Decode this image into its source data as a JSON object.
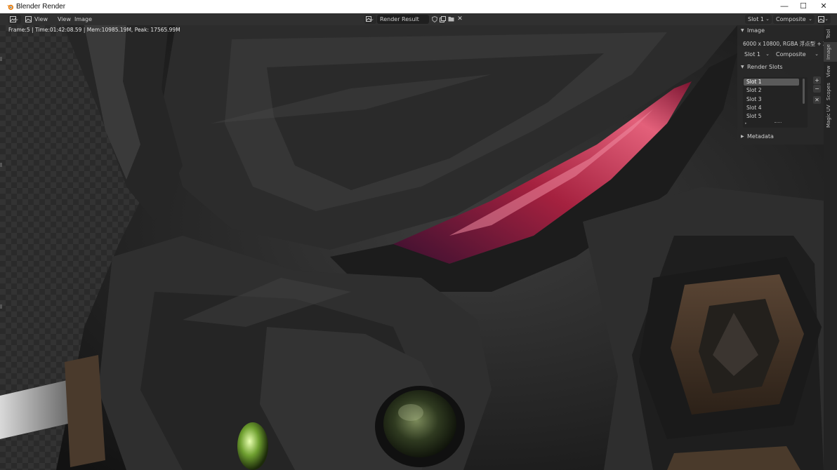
{
  "window": {
    "title": "Blender Render",
    "minimize": "—",
    "maximize": "☐",
    "close": "✕"
  },
  "header": {
    "menus": [
      "View",
      "View",
      "Image"
    ],
    "image_name": "Render Result",
    "slot": "Slot 1",
    "layer": "Composite"
  },
  "status_line": "Frame:5 | Time:01:42:08.59 | Mem:10985.19M, Peak: 17565.99M",
  "sidebar": {
    "image_panel": {
      "title": "Image",
      "resolution": "6000 x 10800, RGBA 浮点型 + Z",
      "slot": "Slot 1",
      "layer": "Composite"
    },
    "render_slots_panel": {
      "title": "Render Slots",
      "slots": [
        "Slot 1",
        "Slot 2",
        "Slot 3",
        "Slot 4",
        "Slot 5"
      ],
      "active_index": 0,
      "add": "+",
      "remove": "−",
      "clear": "✕"
    },
    "metadata_panel": {
      "title": "Metadata"
    }
  },
  "tabs": [
    "Tool",
    "Image",
    "View",
    "Scopes",
    "Magic UV"
  ],
  "active_tab": "Image",
  "icons": {
    "editor_type": "image-editor-icon",
    "image_type": "image-icon",
    "browse": "image-browse-icon",
    "fake_user": "shield-icon",
    "new_image": "new-image-icon",
    "open_image": "folder-icon",
    "unlink": "close-icon",
    "display": "display-mode-icon"
  },
  "colors": {
    "header_bg": "#303030",
    "panel_bg": "#282828",
    "active_slot": "#5a5a5a",
    "accent_red": "#c8264a"
  }
}
